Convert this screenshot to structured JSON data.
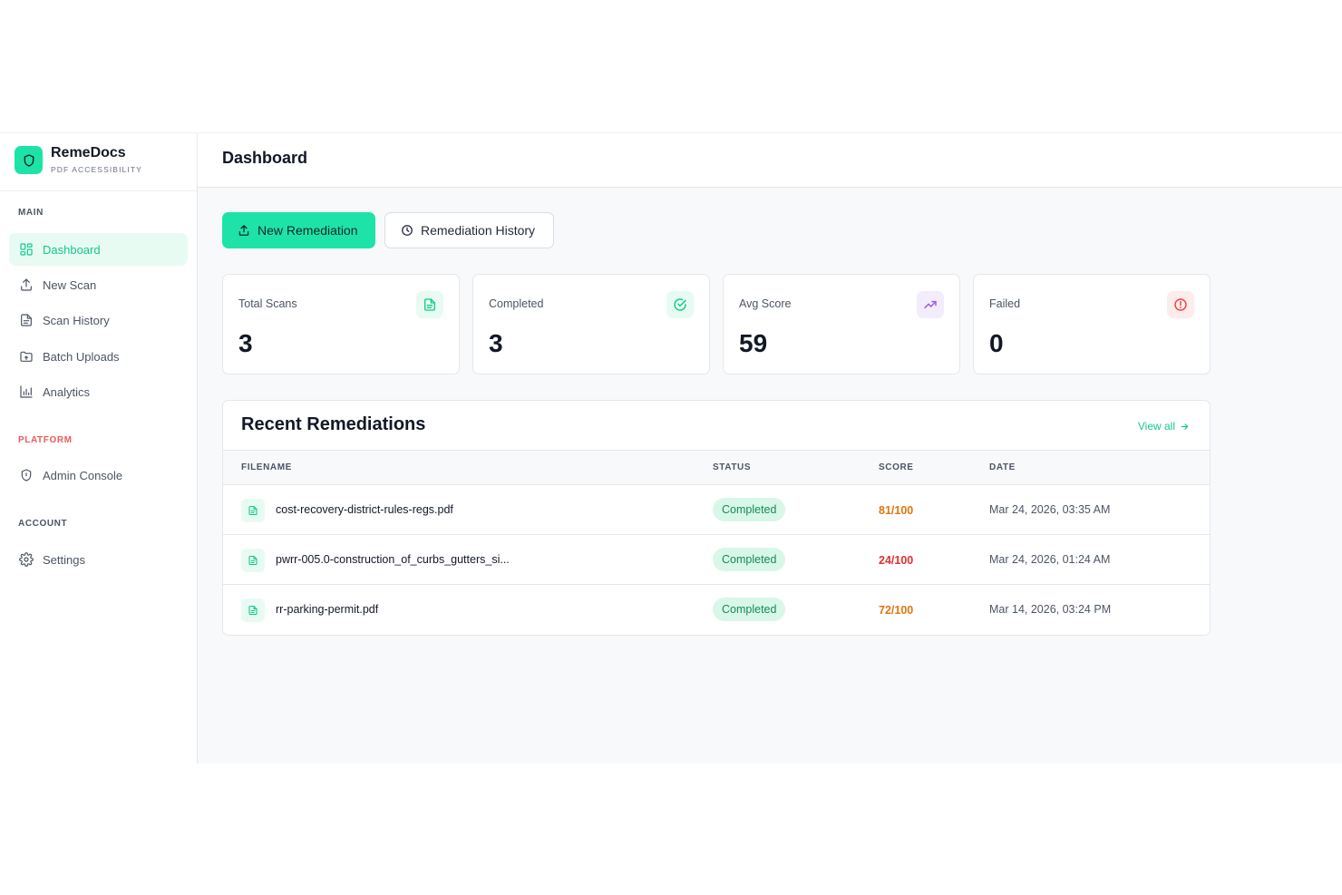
{
  "brand": {
    "name": "RemeDocs",
    "subtitle": "PDF ACCESSIBILITY"
  },
  "sidebar": {
    "sections": {
      "main": "MAIN",
      "platform": "PLATFORM",
      "account": "ACCOUNT"
    },
    "items": [
      {
        "label": "Dashboard",
        "icon": "dashboard-grid-icon",
        "active": true
      },
      {
        "label": "New Scan",
        "icon": "upload-icon"
      },
      {
        "label": "Scan History",
        "icon": "document-icon"
      },
      {
        "label": "Batch Uploads",
        "icon": "folder-icon"
      },
      {
        "label": "Analytics",
        "icon": "bar-chart-icon"
      },
      {
        "label": "Admin Console",
        "icon": "shield-icon"
      },
      {
        "label": "Settings",
        "icon": "gear-icon"
      }
    ]
  },
  "header": {
    "title": "Dashboard"
  },
  "actions": {
    "new_remediation": "New Remediation",
    "remediation_history": "Remediation History"
  },
  "stats": [
    {
      "label": "Total Scans",
      "value": "3",
      "icon": "document-icon",
      "color": "#12c98f",
      "bg": "#e8fbf3"
    },
    {
      "label": "Completed",
      "value": "3",
      "icon": "check-circle-icon",
      "color": "#12c98f",
      "bg": "#e8fbf3"
    },
    {
      "label": "Avg Score",
      "value": "59",
      "icon": "trending-up-icon",
      "color": "#9b5de5",
      "bg": "#f3ecfc"
    },
    {
      "label": "Failed",
      "value": "0",
      "icon": "alert-circle-icon",
      "color": "#ef4444",
      "bg": "#fdecec"
    }
  ],
  "recent": {
    "title": "Recent Remediations",
    "view_all": "View all",
    "columns": [
      "FILENAME",
      "STATUS",
      "SCORE",
      "DATE"
    ],
    "rows": [
      {
        "filename": "cost-recovery-district-rules-regs.pdf",
        "status": "Completed",
        "score": "81/100",
        "score_color": "#e0760e",
        "date": "Mar 24, 2026, 03:35 AM"
      },
      {
        "filename": "pwrr-005.0-construction_of_curbs_gutters_si...",
        "status": "Completed",
        "score": "24/100",
        "score_color": "#e03131",
        "date": "Mar 24, 2026, 01:24 AM"
      },
      {
        "filename": "rr-parking-permit.pdf",
        "status": "Completed",
        "score": "72/100",
        "score_color": "#e0760e",
        "date": "Mar 14, 2026, 03:24 PM"
      }
    ]
  },
  "colors": {
    "accent": "#1ee3a8",
    "accent_text": "#12c98f"
  }
}
